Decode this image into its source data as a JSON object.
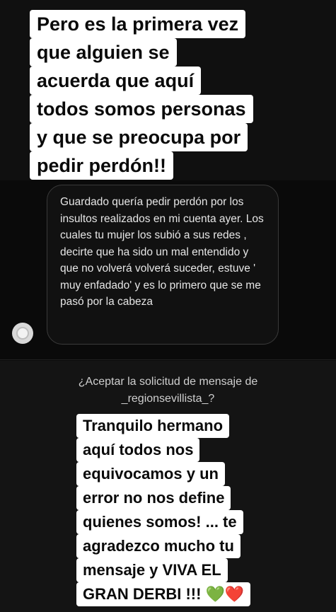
{
  "caption_top": {
    "lines": [
      "Pero es la primera vez",
      "que alguien se",
      "acuerda que aquí",
      "todos somos personas",
      "y que se preocupa por",
      "pedir perdón!!"
    ]
  },
  "message": {
    "text": "Guardado quería pedir perdón por los insultos realizados en mi cuenta ayer. Los cuales tu mujer los subió a sus redes , decirte que ha sido un mal entendido y que no volverá volverá suceder, estuve ' muy enfadado' y es lo primero que se me pasó por la cabeza"
  },
  "request": {
    "prompt": "¿Aceptar la solicitud de mensaje de",
    "username": "_regionsevillista_?"
  },
  "caption_bottom": {
    "lines": [
      "Tranquilo hermano",
      "aquí todos nos",
      "equivocamos y un",
      "error no nos define",
      "quienes somos! ... te",
      "agradezco mucho tu",
      "mensaje y VIVA EL",
      "GRAN DERBI !!! 💚❤️"
    ]
  }
}
